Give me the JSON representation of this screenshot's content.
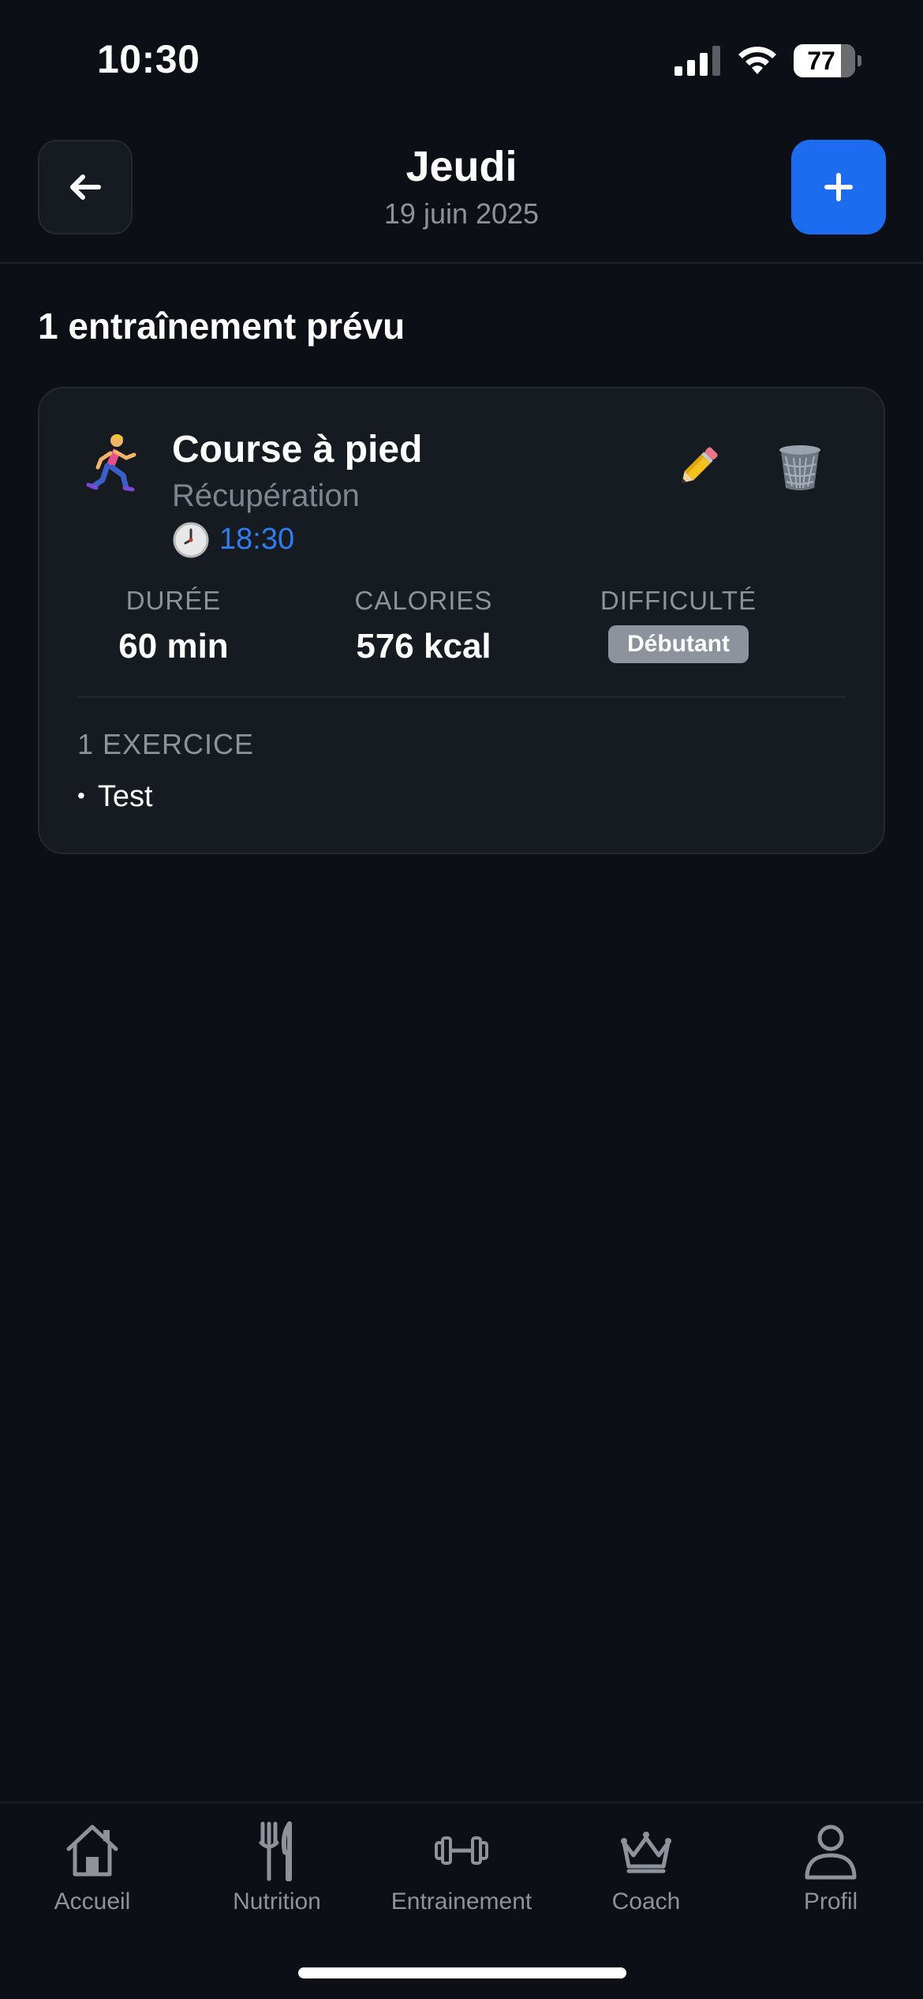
{
  "status_bar": {
    "time": "10:30",
    "battery": "77"
  },
  "header": {
    "title": "Jeudi",
    "subtitle": "19 juin 2025",
    "back_icon": "arrow-left-icon",
    "add_icon": "plus-icon"
  },
  "section": {
    "title": "1 entraînement prévu"
  },
  "workout": {
    "icon": "runner-icon",
    "name": "Course à pied",
    "type": "Récupération",
    "time": "18:30",
    "stats": [
      {
        "label": "DURÉE",
        "value": "60 min"
      },
      {
        "label": "CALORIES",
        "value": "576 kcal"
      },
      {
        "label": "DIFFICULTÉ",
        "value": "Débutant"
      }
    ],
    "exercise_count": "1 EXERCICE",
    "exercises": [
      "Test"
    ]
  },
  "tabs": [
    {
      "label": "Accueil",
      "icon": "home-icon"
    },
    {
      "label": "Nutrition",
      "icon": "fork-knife-icon"
    },
    {
      "label": "Entrainement",
      "icon": "dumbbell-icon"
    },
    {
      "label": "Coach",
      "icon": "crown-icon"
    },
    {
      "label": "Profil",
      "icon": "profile-icon"
    }
  ],
  "colors": {
    "background": "#0c0f16",
    "card": "#161a21",
    "accent": "#1d6cf0",
    "time_accent": "#2d7ef0",
    "muted": "#8d929b"
  }
}
